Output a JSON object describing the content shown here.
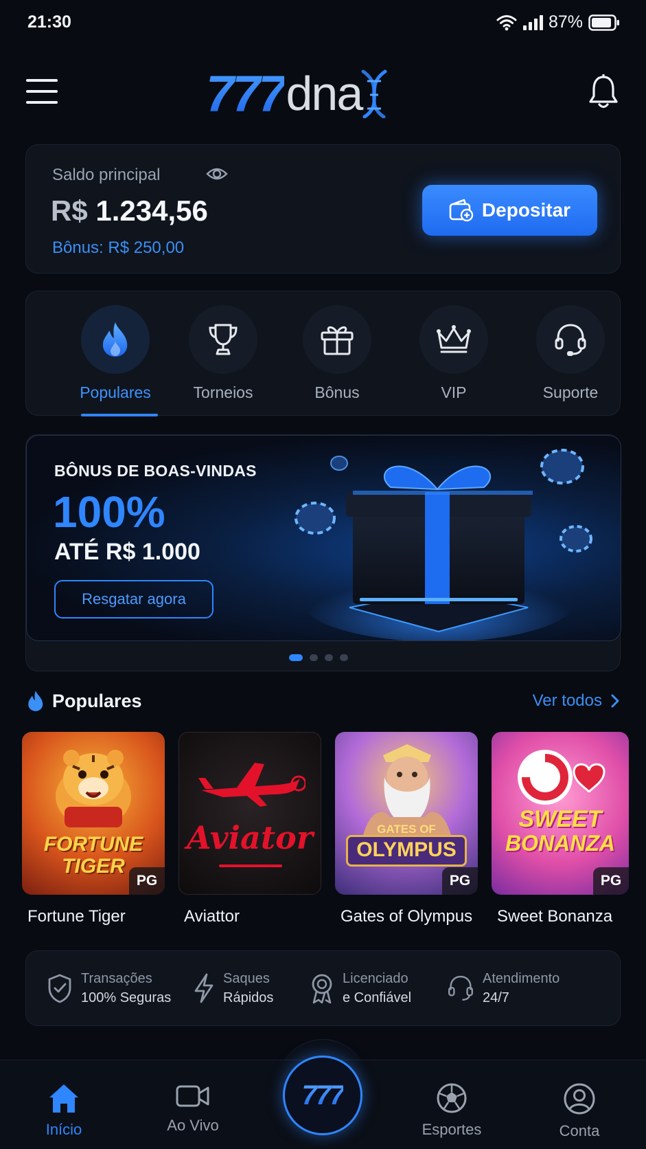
{
  "status_bar": {
    "time": "21:30",
    "battery": "87%"
  },
  "header": {
    "logo_num": "777",
    "logo_text": "dna"
  },
  "balance": {
    "label": "Saldo principal",
    "currency": "R$",
    "amount": "1.234,56",
    "bonus": "Bônus: R$ 250,00",
    "deposit_label": "Depositar"
  },
  "categories": [
    {
      "label": "Populares",
      "icon": "fire-icon",
      "active": true
    },
    {
      "label": "Torneios",
      "icon": "trophy-icon"
    },
    {
      "label": "Bônus",
      "icon": "gift-icon"
    },
    {
      "label": "VIP",
      "icon": "crown-icon"
    },
    {
      "label": "Suporte",
      "icon": "headset-icon"
    }
  ],
  "banner": {
    "kicker": "BÔNUS DE BOAS-VINDAS",
    "percent": "100%",
    "up_to": "ATÉ R$ 1.000",
    "cta": "Resgatar agora",
    "slides": 4,
    "active_slide": 1
  },
  "popular": {
    "title": "Populares",
    "see_all": "Ver todos",
    "games": [
      {
        "name": "Fortune Tiger",
        "art_title": "FORTUNE TIGER",
        "provider": "PG"
      },
      {
        "name": "Aviattor",
        "art_title": "Aviator",
        "provider": ""
      },
      {
        "name": "Gates of Olympus",
        "art_title": "OLYMPUS",
        "art_sub": "GATES OF",
        "provider": "PG"
      },
      {
        "name": "Sweet Bonanza",
        "art_title": "BONANZA",
        "art_sub": "SWEET",
        "provider": "PG"
      }
    ]
  },
  "trust": [
    {
      "line1": "Transações",
      "line2": "100% Seguras",
      "icon": "shield-check-icon"
    },
    {
      "line1": "Saques",
      "line2": "Rápidos",
      "icon": "lightning-icon"
    },
    {
      "line1": "Licenciado",
      "line2": "e Confiável",
      "icon": "award-icon"
    },
    {
      "line1": "Atendimento",
      "line2": "24/7",
      "icon": "headset-icon"
    }
  ],
  "bottom_nav": {
    "items": [
      {
        "label": "Início",
        "icon": "home-icon",
        "active": true
      },
      {
        "label": "Ao Vivo",
        "icon": "video-icon"
      },
      {
        "label": "Esportes",
        "icon": "soccer-ball-icon"
      },
      {
        "label": "Conta",
        "icon": "user-icon"
      }
    ],
    "center_label": "777"
  },
  "colors": {
    "accent": "#2f86ff",
    "background": "#080b12",
    "card": "#0f141d"
  }
}
